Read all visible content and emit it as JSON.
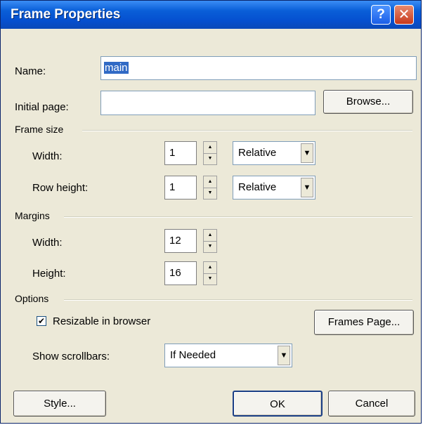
{
  "window": {
    "title": "Frame Properties",
    "help_label": "?",
    "close_label": "✕"
  },
  "name": {
    "label": "Name:",
    "value": "main"
  },
  "initial_page": {
    "label": "Initial page:",
    "value": "",
    "browse_label": "Browse..."
  },
  "frame_size": {
    "heading": "Frame size",
    "width": {
      "label": "Width:",
      "value": "1",
      "unit": "Relative"
    },
    "row_height": {
      "label": "Row height:",
      "value": "1",
      "unit": "Relative"
    }
  },
  "margins": {
    "heading": "Margins",
    "width": {
      "label": "Width:",
      "value": "12"
    },
    "height": {
      "label": "Height:",
      "value": "16"
    }
  },
  "options": {
    "heading": "Options",
    "resizable": {
      "label": "Resizable in browser",
      "checked": true
    },
    "frames_page_label": "Frames Page...",
    "show_scrollbars": {
      "label": "Show scrollbars:",
      "value": "If Needed"
    }
  },
  "footer": {
    "style_label": "Style...",
    "ok_label": "OK",
    "cancel_label": "Cancel"
  },
  "icons": {
    "spin_up": "▲",
    "spin_down": "▼",
    "dropdown": "▼",
    "check": "✔"
  },
  "colors": {
    "titlebar": "#0a5fd8",
    "selection": "#316ac5",
    "dialog_bg": "#ece9d8"
  }
}
